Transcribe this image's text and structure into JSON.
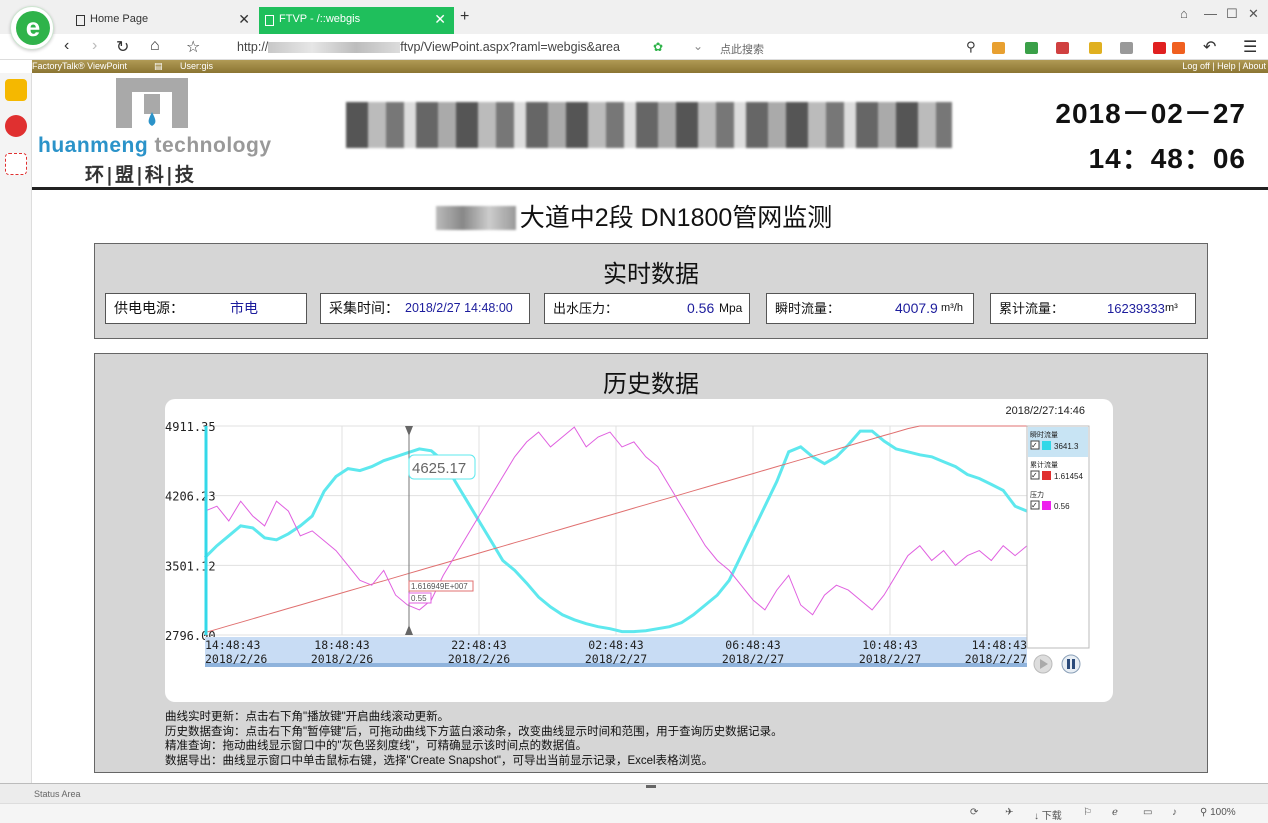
{
  "browser": {
    "tabs": [
      {
        "label": "Home Page"
      },
      {
        "label": "FTVP - /::webgis"
      }
    ],
    "new_tab": "+",
    "address_prefix": "http://",
    "address_suffix": "ftvp/ViewPoint.aspx?raml=webgis&area",
    "search_placeholder": "点此搜索",
    "zoom": "100%",
    "download_label": "下载",
    "status_area": "Status Area"
  },
  "favbar": {
    "product": "FactoryTalk® ViewPoint",
    "user": "User:gis",
    "links": "Log off | Help | About"
  },
  "brand": {
    "name_a": "huanmeng",
    "name_b": " technology",
    "cn": "环|盟|科|技"
  },
  "header": {
    "date": "2018－02－27",
    "time": "14：48：06"
  },
  "page_title": "大道中2段 DN1800管网监测",
  "realtime": {
    "title": "实时数据",
    "power": {
      "label": "供电电源：",
      "value": "市电"
    },
    "collect": {
      "label": "采集时间：",
      "value": "2018/2/27 14:48:00"
    },
    "pressure": {
      "label": "出水压力：",
      "value": "0.56",
      "unit": "Mpa"
    },
    "flow": {
      "label": "瞬时流量：",
      "value": "4007.9",
      "unit": "m³/h"
    },
    "total": {
      "label": "累计流量：",
      "value": "16239333",
      "unit": "m³"
    }
  },
  "history": {
    "title": "历史数据",
    "help": [
      "曲线实时更新：点击右下角\"播放键\"开启曲线滚动更新。",
      "历史数据查询：点击右下角\"暂停键\"后，可拖动曲线下方蓝白滚动条，改变曲线显示时间和范围，用于查询历史数据记录。",
      "精准查询：拖动曲线显示窗口中的\"灰色竖刻度线\"，可精确显示该时间点的数据值。",
      "数据导出：曲线显示窗口中单击鼠标右键，选择\"Create Snapshot\"，可导出当前显示记录，Excel表格浏览。"
    ]
  },
  "chart_data": {
    "type": "line",
    "timestamp": "2018/2/27:14:46",
    "ylim": [
      2796.0,
      4911.35
    ],
    "y_ticks": [
      "4911.35",
      "4206.23",
      "3501.12",
      "2796.00"
    ],
    "x_ticks": [
      {
        "time": "14:48:43",
        "date": "2018/2/26"
      },
      {
        "time": "18:48:43",
        "date": "2018/2/26"
      },
      {
        "time": "22:48:43",
        "date": "2018/2/26"
      },
      {
        "time": "02:48:43",
        "date": "2018/2/27"
      },
      {
        "time": "06:48:43",
        "date": "2018/2/27"
      },
      {
        "time": "10:48:43",
        "date": "2018/2/27"
      },
      {
        "time": "14:48:43",
        "date": "2018/2/27"
      }
    ],
    "cursor_value": "4625.17",
    "cursor_total": "1.616949E+007",
    "cursor_pressure": "0.55",
    "legend": [
      {
        "name": "瞬时流量",
        "value": "3641.3",
        "color": "#33d8e8"
      },
      {
        "name": "累计流量",
        "value": "1.61454",
        "color": "#e03030"
      },
      {
        "name": "压力",
        "value": "0.56",
        "color": "#ee22ee"
      }
    ],
    "series": [
      {
        "name": "瞬时流量",
        "color": "#5ee8ee",
        "values": [
          3580,
          3700,
          3800,
          3900,
          3880,
          3780,
          3760,
          3820,
          3900,
          4000,
          4250,
          4400,
          4480,
          4460,
          4500,
          4560,
          4600,
          4640,
          4680,
          4660,
          4560,
          4350,
          4150,
          3950,
          3750,
          3550,
          3450,
          3320,
          3180,
          3080,
          3000,
          2950,
          2910,
          2880,
          2860,
          2830,
          2830,
          2840,
          2860,
          2880,
          2920,
          3000,
          3100,
          3200,
          3350,
          3600,
          3850,
          4100,
          4350,
          4650,
          4700,
          4600,
          4530,
          4600,
          4720,
          4860,
          4860,
          4760,
          4680,
          4650,
          4620,
          4600,
          4550,
          4500,
          4420,
          4380,
          4320,
          4260,
          4100,
          4050
        ]
      },
      {
        "name": "累计流量",
        "color": "#e07070",
        "values": [
          2820,
          2855,
          2890,
          2925,
          2960,
          2995,
          3030,
          3065,
          3100,
          3135,
          3170,
          3205,
          3240,
          3275,
          3310,
          3345,
          3380,
          3415,
          3450,
          3485,
          3520,
          3555,
          3590,
          3625,
          3660,
          3695,
          3730,
          3765,
          3800,
          3835,
          3870,
          3905,
          3940,
          3975,
          4010,
          4045,
          4080,
          4115,
          4150,
          4185,
          4220,
          4255,
          4290,
          4325,
          4360,
          4395,
          4430,
          4465,
          4500,
          4535,
          4570,
          4605,
          4640,
          4675,
          4710,
          4745,
          4780,
          4815,
          4850,
          4885,
          4911,
          4911,
          4911,
          4911,
          4911,
          4911,
          4911,
          4911,
          4911,
          4911
        ]
      },
      {
        "name": "压力",
        "color": "#e060e0",
        "values": [
          4050,
          4100,
          3950,
          4150,
          4000,
          3900,
          4150,
          4050,
          3800,
          3850,
          3750,
          3650,
          3500,
          3350,
          3300,
          3450,
          3200,
          3100,
          3050,
          3150,
          3400,
          3600,
          3800,
          4000,
          4200,
          4400,
          4600,
          4750,
          4850,
          4700,
          4800,
          4900,
          4700,
          4800,
          4850,
          4700,
          4750,
          4600,
          4500,
          4300,
          4100,
          3900,
          3700,
          3550,
          3450,
          3300,
          3150,
          3050,
          3250,
          3400,
          3100,
          3000,
          3200,
          3300,
          3250,
          3150,
          3050,
          3200,
          3400,
          3600,
          3700,
          3550,
          3650,
          3500,
          3600,
          3650,
          3550,
          3700,
          3600,
          3700
        ]
      }
    ]
  }
}
